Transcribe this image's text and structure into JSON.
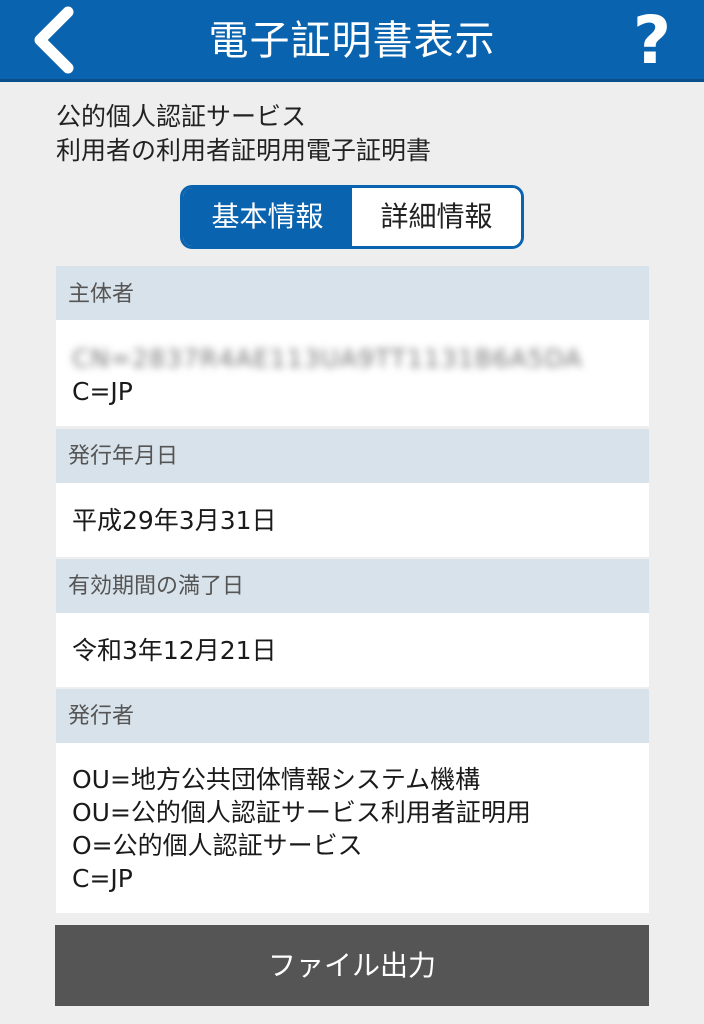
{
  "header": {
    "title": "電子証明書表示",
    "help_label": "?"
  },
  "certificate": {
    "description_lines": [
      "公的個人認証サービス",
      "利用者の利用者証明用電子証明書"
    ]
  },
  "tabs": [
    {
      "label": "基本情報",
      "active": true
    },
    {
      "label": "詳細情報",
      "active": false
    }
  ],
  "sections": {
    "subject": {
      "label": "主体者",
      "redacted_line": "CN=2837R4AE113UA9TT1131B6A5DA",
      "country": "C=JP"
    },
    "issue_date": {
      "label": "発行年月日",
      "value": "平成29年3月31日"
    },
    "expiry_date": {
      "label": "有効期間の満了日",
      "value": "令和3年12月21日"
    },
    "issuer": {
      "label": "発行者",
      "lines": [
        "OU=地方公共団体情報システム機構",
        "OU=公的個人認証サービス利用者証明用",
        "O=公的個人認証サービス",
        "C=JP"
      ]
    }
  },
  "footer": {
    "file_output_label": "ファイル出力"
  },
  "colors": {
    "header_bg": "#0a63ae",
    "section_header_bg": "#d8e2ea",
    "button_bg": "#555555"
  }
}
